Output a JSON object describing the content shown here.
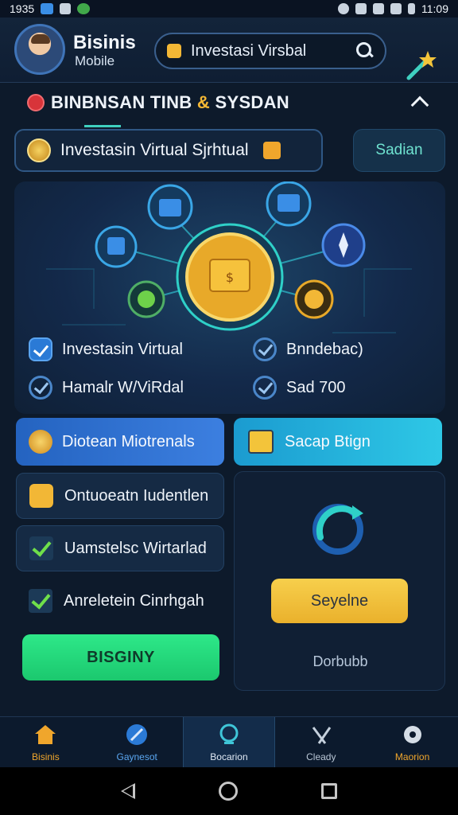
{
  "status_bar": {
    "time_left": "1935",
    "time_right": "11:09"
  },
  "header": {
    "app_title": "Bisinis",
    "app_subtitle": "Mobile",
    "search_value": "Investasi Virsbal"
  },
  "section": {
    "title_part1": "BINBNSAN TINB ",
    "title_amp": "&",
    "title_part2": " SYSDAN"
  },
  "pill": {
    "main_label": "Investasin Virtual Sjrhtual",
    "side_label": "Sadian"
  },
  "features": [
    {
      "label": "Investasin Virtual"
    },
    {
      "label": "Bnndebac)"
    },
    {
      "label": "Hamalr W/ViRdal"
    },
    {
      "label": "Sad 700"
    }
  ],
  "buttons": {
    "blue_label": "Diotean Miotrenals",
    "cyan_label": "Sacap Btign",
    "green_label": "BISGINY",
    "yellow_label": "Seyelne"
  },
  "list_rows": [
    {
      "label": "Ontuoeatn Iudentlen"
    },
    {
      "label": "Uamstelsc Wirtarlad"
    },
    {
      "label": "Anreletein Cinrhgah"
    }
  ],
  "right_caption": "Dorbubb",
  "bottom_nav": [
    {
      "label": "Bisinis",
      "color": "#f0a62c"
    },
    {
      "label": "Gaynesot",
      "color": "#5aa6f0"
    },
    {
      "label": "Bocarion",
      "color": "#dfe8f3"
    },
    {
      "label": "Cleady",
      "color": "#b9c6d5"
    },
    {
      "label": "Maorion",
      "color": "#f0a62c"
    }
  ],
  "colors": {
    "accent_cyan": "#3fd0c0",
    "accent_gold": "#f3b735",
    "accent_green": "#2ee889"
  }
}
